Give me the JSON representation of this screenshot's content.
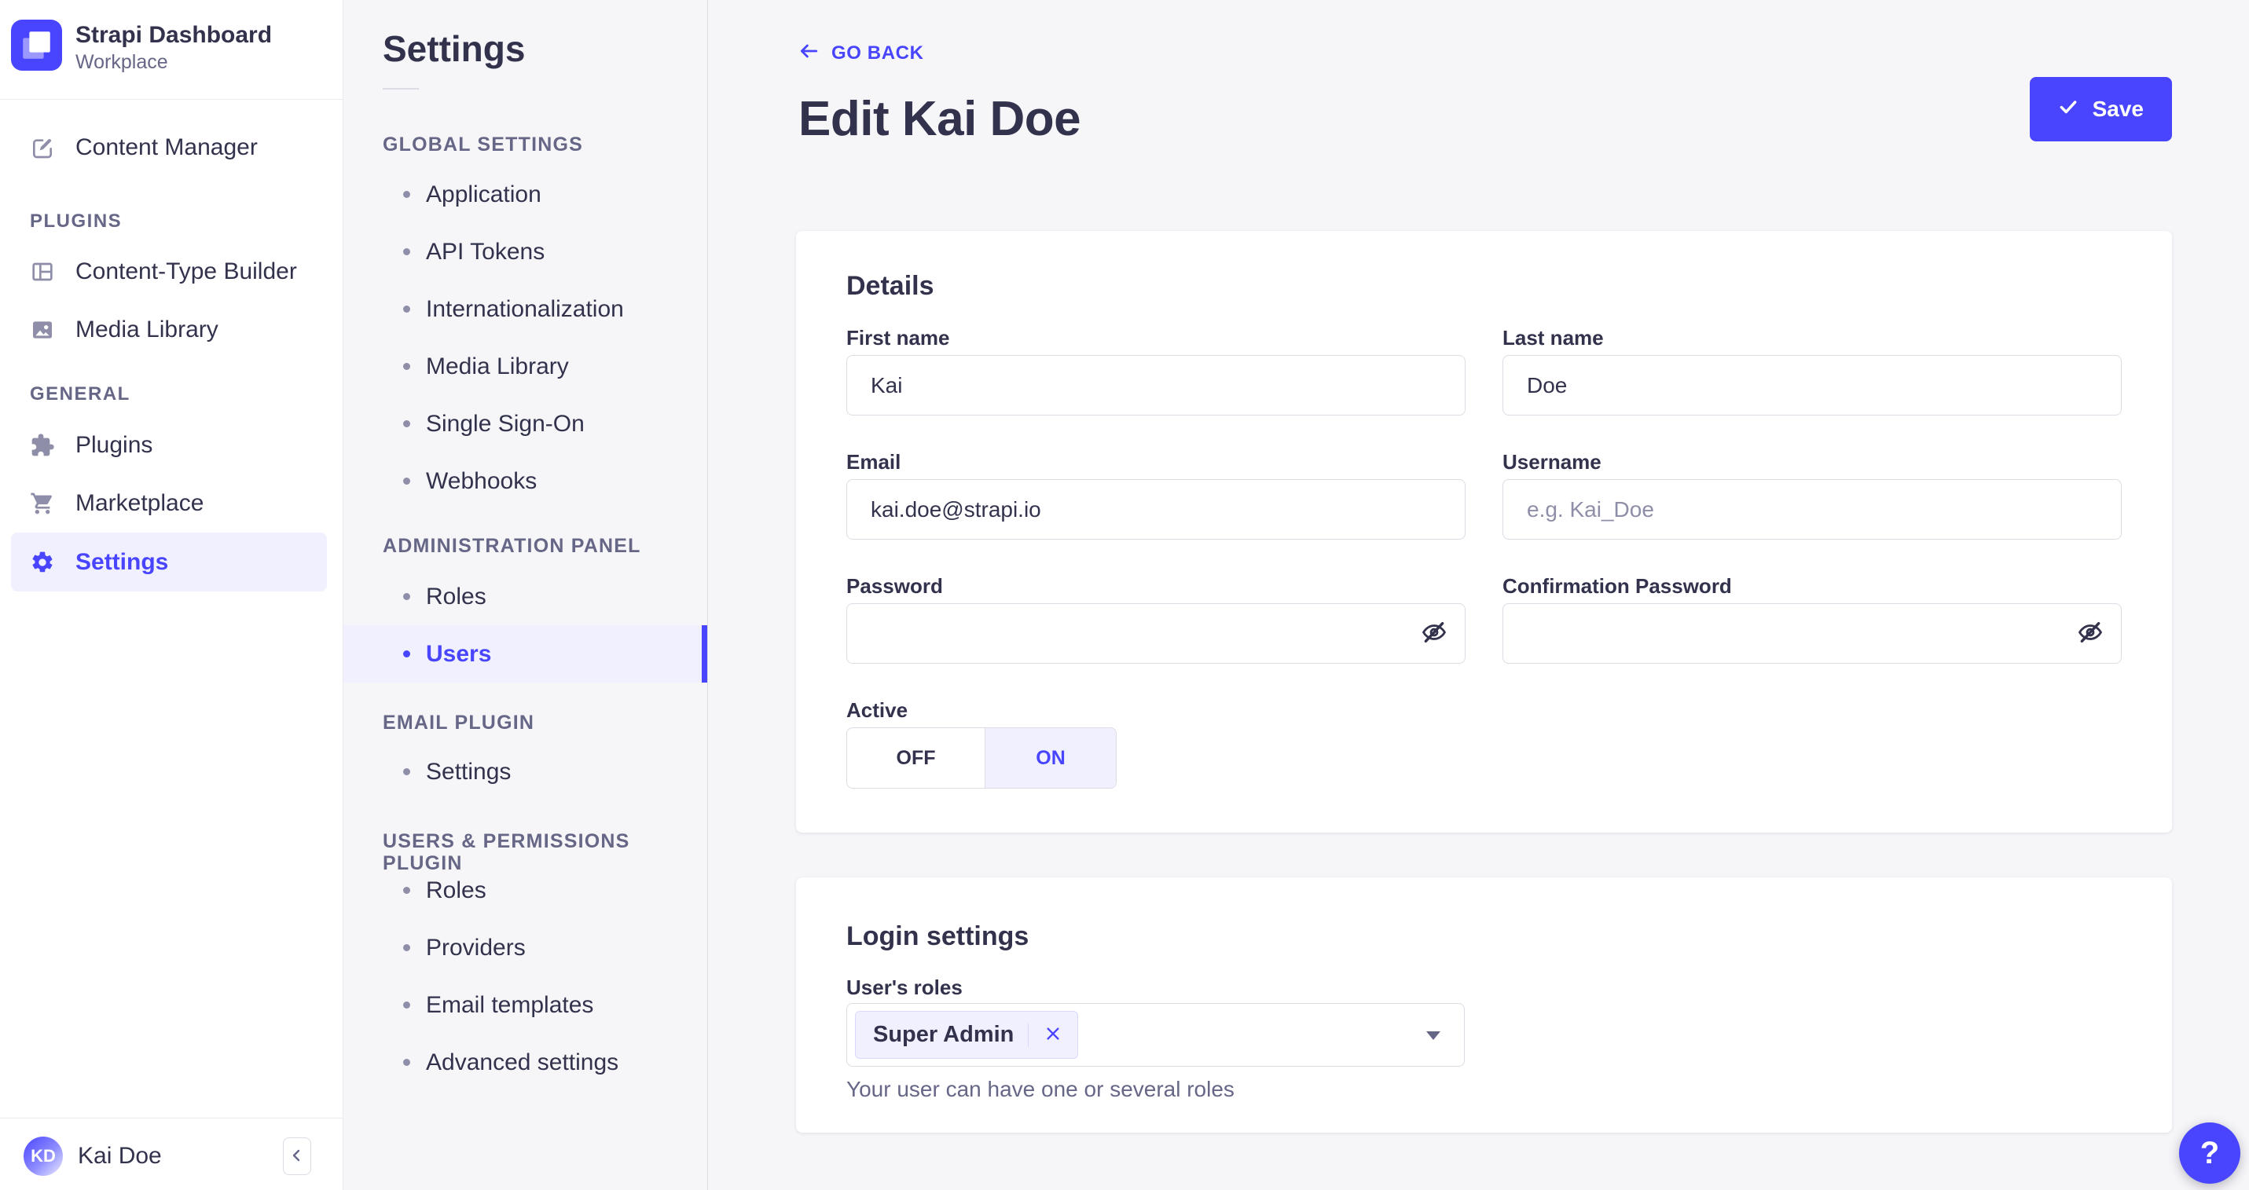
{
  "colors": {
    "accent": "#4945FF",
    "accent_light_bg": "#F0F0FF",
    "accent_tag_border": "#D9D8FF",
    "text_dark": "#32324D",
    "text_muted": "#666687",
    "placeholder": "#8E8EA9",
    "border_input": "#DCDCE4",
    "border_subtle": "#EAEAEF",
    "page_bg": "#F6F6F9",
    "card_bg": "#FFFFFF"
  },
  "sidebar": {
    "brand": {
      "title": "Strapi Dashboard",
      "workplace": "Workplace"
    },
    "items_top": [
      {
        "label": "Content Manager"
      }
    ],
    "sections": [
      {
        "header": "PLUGINS",
        "items": [
          "Content-Type Builder",
          "Media Library"
        ]
      },
      {
        "header": "GENERAL",
        "items": [
          "Plugins",
          "Marketplace",
          "Settings"
        ]
      }
    ],
    "active_item": "Settings",
    "user": {
      "initials": "KD",
      "name": "Kai Doe"
    }
  },
  "subnav": {
    "title": "Settings",
    "sections": [
      {
        "header": "GLOBAL SETTINGS",
        "items": [
          "Application",
          "API Tokens",
          "Internationalization",
          "Media Library",
          "Single Sign-On",
          "Webhooks"
        ]
      },
      {
        "header": "ADMINISTRATION PANEL",
        "items": [
          "Roles",
          "Users"
        ]
      },
      {
        "header": "EMAIL PLUGIN",
        "items": [
          "Settings"
        ]
      },
      {
        "header": "USERS & PERMISSIONS PLUGIN",
        "items": [
          "Roles",
          "Providers",
          "Email templates",
          "Advanced settings"
        ]
      }
    ],
    "active_item": "Users"
  },
  "header": {
    "back_label": "GO BACK",
    "title": "Edit Kai Doe",
    "save_label": "Save"
  },
  "details": {
    "title": "Details",
    "fields": {
      "first_name": {
        "label": "First name",
        "value": "Kai"
      },
      "last_name": {
        "label": "Last name",
        "value": "Doe"
      },
      "email": {
        "label": "Email",
        "value": "kai.doe@strapi.io"
      },
      "username": {
        "label": "Username",
        "value": "",
        "placeholder": "e.g. Kai_Doe"
      },
      "password": {
        "label": "Password"
      },
      "confirmation_password": {
        "label": "Confirmation Password"
      },
      "active": {
        "label": "Active",
        "off": "OFF",
        "on": "ON",
        "value": "ON"
      }
    }
  },
  "login": {
    "title": "Login settings",
    "roles": {
      "label": "User's roles",
      "selected": [
        "Super Admin"
      ],
      "helper": "Your user can have one or several roles"
    }
  },
  "help": {
    "label": "?"
  }
}
